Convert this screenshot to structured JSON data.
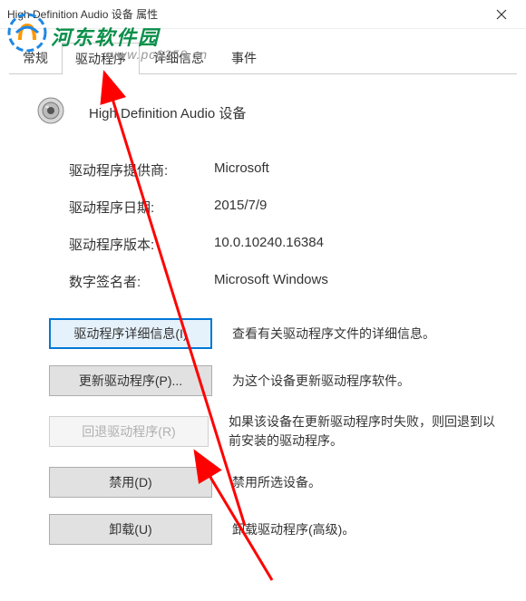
{
  "window": {
    "title": "High Definition Audio 设备 属性"
  },
  "watermark": {
    "text": "河东软件园",
    "url": "www.pc0359.cn"
  },
  "tabs": {
    "t0": "常规",
    "t1": "驱动程序",
    "t2": "详细信息",
    "t3": "事件"
  },
  "device": {
    "name": "High Definition Audio 设备"
  },
  "info": {
    "provider_label": "驱动程序提供商:",
    "provider_value": "Microsoft",
    "date_label": "驱动程序日期:",
    "date_value": "2015/7/9",
    "version_label": "驱动程序版本:",
    "version_value": "10.0.10240.16384",
    "signer_label": "数字签名者:",
    "signer_value": "Microsoft Windows"
  },
  "buttons": {
    "details_label": "驱动程序详细信息(I)",
    "details_desc": "查看有关驱动程序文件的详细信息。",
    "update_label": "更新驱动程序(P)...",
    "update_desc": "为这个设备更新驱动程序软件。",
    "rollback_label": "回退驱动程序(R)",
    "rollback_desc": "如果该设备在更新驱动程序时失败，则回退到以前安装的驱动程序。",
    "disable_label": "禁用(D)",
    "disable_desc": "禁用所选设备。",
    "uninstall_label": "卸载(U)",
    "uninstall_desc": "卸载驱动程序(高级)。"
  }
}
